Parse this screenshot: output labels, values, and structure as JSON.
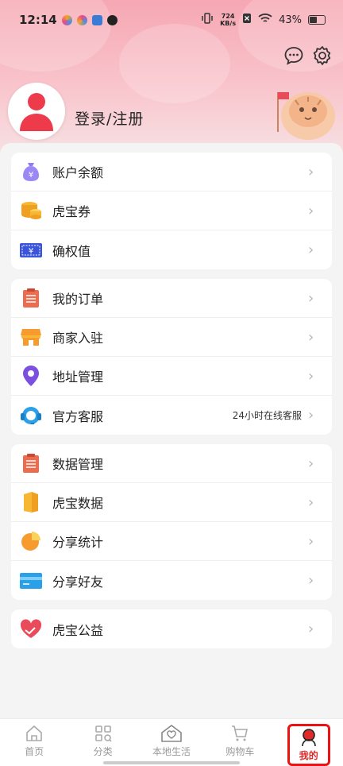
{
  "status_bar": {
    "time": "12:14",
    "speed_value": "724",
    "speed_unit": "KB/s",
    "battery_percent": "43%"
  },
  "profile": {
    "login_label": "登录/注册"
  },
  "groups": [
    {
      "items": [
        {
          "label": "账户余额",
          "icon": "money-bag-icon"
        },
        {
          "label": "虎宝券",
          "icon": "coins-icon"
        },
        {
          "label": "确权值",
          "icon": "ticket-icon"
        }
      ]
    },
    {
      "items": [
        {
          "label": "我的订单",
          "icon": "order-list-icon"
        },
        {
          "label": "商家入驻",
          "icon": "store-icon"
        },
        {
          "label": "地址管理",
          "icon": "location-pin-icon"
        },
        {
          "label": "官方客服",
          "icon": "customer-service-icon",
          "sub": "24小时在线客服"
        }
      ]
    },
    {
      "items": [
        {
          "label": "数据管理",
          "icon": "data-list-icon"
        },
        {
          "label": "虎宝数据",
          "icon": "data-book-icon"
        },
        {
          "label": "分享统计",
          "icon": "pie-chart-icon"
        },
        {
          "label": "分享好友",
          "icon": "card-icon"
        }
      ]
    },
    {
      "items": [
        {
          "label": "虎宝公益",
          "icon": "heart-hands-icon"
        }
      ]
    }
  ],
  "tabbar": [
    {
      "label": "首页",
      "icon": "home-icon"
    },
    {
      "label": "分类",
      "icon": "category-icon"
    },
    {
      "label": "本地生活",
      "icon": "local-life-icon"
    },
    {
      "label": "购物车",
      "icon": "cart-icon"
    },
    {
      "label": "我的",
      "icon": "profile-icon",
      "active": true
    }
  ]
}
